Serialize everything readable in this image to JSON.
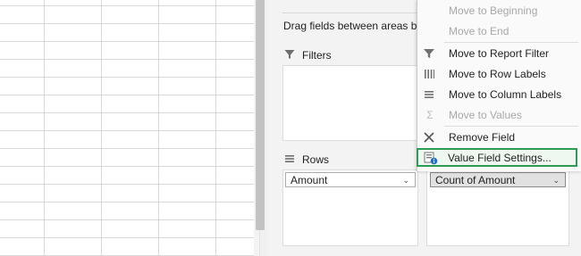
{
  "pane": {
    "drag_hint": "Drag fields between areas below:",
    "filters_label": "Filters",
    "rows_label": "Rows",
    "rows_field": "Amount",
    "values_field": "Count of Amount"
  },
  "menu": {
    "items": [
      {
        "label": "Move to Beginning",
        "enabled": false,
        "icon": "none"
      },
      {
        "label": "Move to End",
        "enabled": false,
        "icon": "none"
      },
      {
        "label": "Move to Report Filter",
        "enabled": true,
        "icon": "filter-icon"
      },
      {
        "label": "Move to Row Labels",
        "enabled": true,
        "icon": "row-labels-icon"
      },
      {
        "label": "Move to Column Labels",
        "enabled": true,
        "icon": "column-labels-icon"
      },
      {
        "label": "Move to Values",
        "enabled": false,
        "icon": "sigma-icon"
      },
      {
        "label": "Remove Field",
        "enabled": true,
        "icon": "close-icon"
      },
      {
        "label": "Value Field Settings...",
        "enabled": true,
        "icon": "field-settings-icon",
        "highlighted": true
      }
    ]
  },
  "colors": {
    "highlight": "#2e9b53",
    "pane_bg": "#f3f3f3",
    "disabled_text": "#a8a8a8"
  }
}
